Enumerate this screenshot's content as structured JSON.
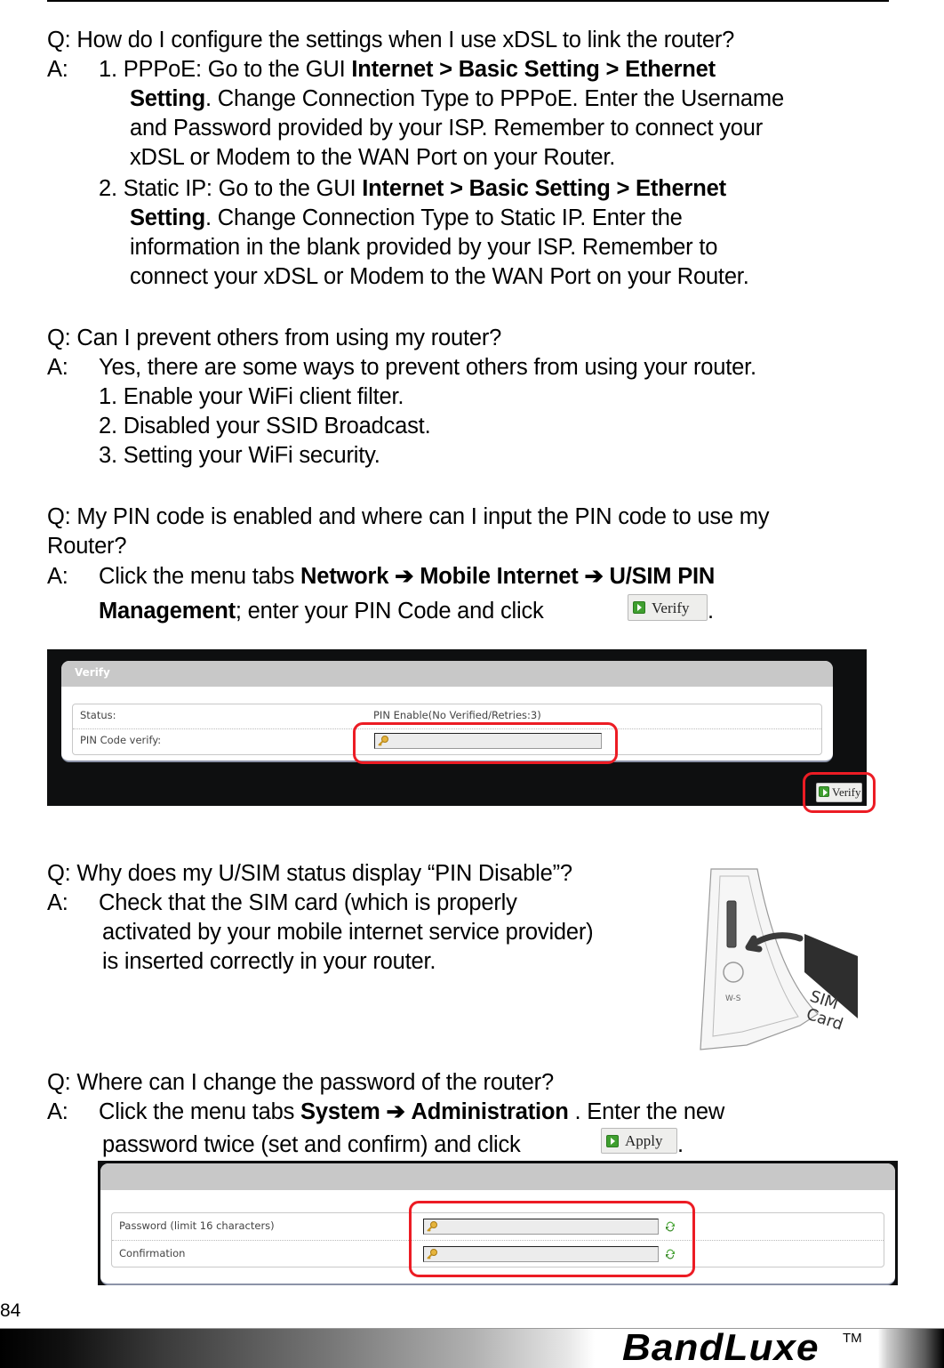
{
  "page": {
    "number": "84",
    "brand": "BandLuxe",
    "trademark": "TM"
  },
  "faq": [
    {
      "question": "Q: How do I configure the settings when I use xDSL to link the router?",
      "answer_label": "A:",
      "items": [
        {
          "prefix": "1. PPPoE: Go to the GUI ",
          "path": "Internet > Basic Setting > Ethernet",
          "path2": "Setting",
          "line2_rest": ". Change Connection Type to PPPoE. Enter the Username",
          "line3": "and Password provided by your ISP. Remember to connect your",
          "line4": "xDSL or Modem to the WAN Port on your Router."
        },
        {
          "prefix": "2. Static IP: Go to the GUI ",
          "path": "Internet > Basic Setting > Ethernet",
          "path2": "Setting",
          "line2_rest": ". Change Connection Type to Static IP. Enter the",
          "line3": "information in the blank provided by your ISP. Remember to",
          "line4": "connect your xDSL or Modem to the WAN Port on your Router."
        }
      ]
    },
    {
      "question": "Q: Can I prevent others from using my router?",
      "answer_label": "A:",
      "answer": "Yes, there are some ways to prevent others from using your router.",
      "steps": [
        "1. Enable your WiFi client filter.",
        "2. Disabled your SSID Broadcast.",
        "3. Setting your WiFi security."
      ]
    },
    {
      "question_line1": "Q: My PIN code is enabled and where can I input the PIN code to use my",
      "question_line2": "Router?",
      "answer_label": "A:",
      "answer_prefix": "Click the menu tabs ",
      "menu1": "Network",
      "arrow": "➔",
      "menu2": "Mobile Internet",
      "menu3": "U/SIM PIN",
      "menu3b": "Management",
      "answer_rest": "; enter your PIN Code and click ",
      "button_label": "Verify",
      "end": "."
    },
    {
      "question": "Q: Why does my U/SIM status display “PIN Disable”?",
      "answer_label": "A:",
      "line1": "Check that the SIM card (which is properly",
      "line2": "activated by your mobile internet service provider)",
      "line3": "is inserted correctly in your router.",
      "illustration": {
        "label_line1": "SIM",
        "label_line2": "Card"
      }
    },
    {
      "question": "Q: Where can I change the password of the router?",
      "answer_label": "A:",
      "answer_prefix": "Click the menu tabs ",
      "menu1": "System",
      "arrow": "➔",
      "menu2": "Administration",
      "answer_rest": " . Enter the new",
      "line2": "password twice (set and confirm) and click ",
      "button_label": "Apply",
      "end": "."
    }
  ],
  "verify_screen": {
    "panel_title": "Verify",
    "rows": [
      {
        "label": "Status:",
        "value": "PIN Enable(No Verified/Retries:3)"
      },
      {
        "label": "PIN Code verify:",
        "value": ""
      }
    ],
    "button_label": "Verify",
    "highlight_color": "#ec1c24"
  },
  "password_screen": {
    "panel_title": "",
    "rows": [
      {
        "label": "Password (limit 16 characters)",
        "value": ""
      },
      {
        "label": "Confirmation",
        "value": ""
      }
    ]
  }
}
